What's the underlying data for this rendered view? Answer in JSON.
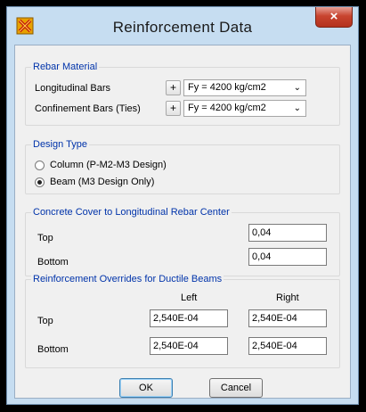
{
  "window": {
    "title": "Reinforcement Data",
    "close_label": "×",
    "app_icon": "x-app-icon"
  },
  "rebar_material": {
    "legend": "Rebar Material",
    "rows": [
      {
        "label": "Longitudinal Bars",
        "plus": "+",
        "value": "Fy = 4200 kg/cm2"
      },
      {
        "label": "Confinement Bars  (Ties)",
        "plus": "+",
        "value": "Fy = 4200 kg/cm2"
      }
    ]
  },
  "design_type": {
    "legend": "Design Type",
    "options": [
      {
        "label": "Column  (P-M2-M3 Design)",
        "checked": false
      },
      {
        "label": "Beam  (M3 Design Only)",
        "checked": true
      }
    ]
  },
  "concrete_cover": {
    "legend": "Concrete Cover to Longitudinal Rebar Center",
    "top_label": "Top",
    "top_value": "0,04",
    "bottom_label": "Bottom",
    "bottom_value": "0,04"
  },
  "overrides": {
    "legend": "Reinforcement Overrides for Ductile Beams",
    "left_header": "Left",
    "right_header": "Right",
    "top_label": "Top",
    "top_left": "2,540E-04",
    "top_right": "2,540E-04",
    "bottom_label": "Bottom",
    "bottom_left": "2,540E-04",
    "bottom_right": "2,540E-04"
  },
  "buttons": {
    "ok": "OK",
    "cancel": "Cancel"
  },
  "colors": {
    "frame": "#c6ddf1",
    "legend_text": "#0033aa",
    "close_button": "#c8442f"
  }
}
